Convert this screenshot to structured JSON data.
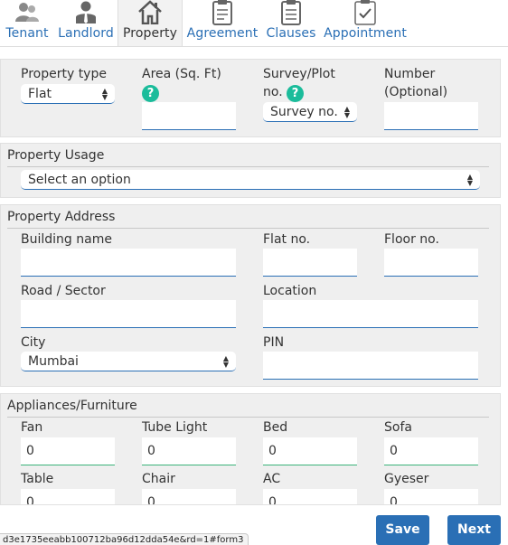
{
  "tabs": [
    {
      "label": "Tenant",
      "icon": "tenant-icon"
    },
    {
      "label": "Landlord",
      "icon": "landlord-icon"
    },
    {
      "label": "Property",
      "icon": "house-icon"
    },
    {
      "label": "Agreement",
      "icon": "clipboard-icon"
    },
    {
      "label": "Clauses",
      "icon": "clipboard-list-icon"
    },
    {
      "label": "Appointment",
      "icon": "clipboard-check-icon"
    }
  ],
  "property": {
    "type_label": "Property type",
    "type_value": "Flat",
    "area_label": "Area (Sq. Ft)",
    "area_value": "",
    "survey_label_1": "Survey/Plot",
    "survey_label_2": "no.",
    "survey_value": "Survey no.",
    "number_label_1": "Number",
    "number_label_2": "(Optional)",
    "number_value": ""
  },
  "usage": {
    "legend": "Property Usage",
    "value": "Select an option"
  },
  "address": {
    "legend": "Property Address",
    "building_label": "Building name",
    "flat_label": "Flat no.",
    "floor_label": "Floor no.",
    "road_label": "Road / Sector",
    "location_label": "Location",
    "city_label": "City",
    "city_value": "Mumbai",
    "pin_label": "PIN"
  },
  "appliances": {
    "legend": "Appliances/Furniture",
    "items": [
      {
        "label": "Fan",
        "value": "0"
      },
      {
        "label": "Tube Light",
        "value": "0"
      },
      {
        "label": "Bed",
        "value": "0"
      },
      {
        "label": "Sofa",
        "value": "0"
      },
      {
        "label": "Table",
        "value": "0"
      },
      {
        "label": "Chair",
        "value": "0"
      },
      {
        "label": "AC",
        "value": "0"
      },
      {
        "label": "Gyeser",
        "value": "0"
      }
    ]
  },
  "status_url": "d3e1735eeabb100712ba96d12dda54e&rd=1#form3",
  "buttons": {
    "save": "Save",
    "next": "Next"
  },
  "colors": {
    "accent": "#2a6fb5",
    "help": "#1bbc9b",
    "panel": "#efefef"
  }
}
